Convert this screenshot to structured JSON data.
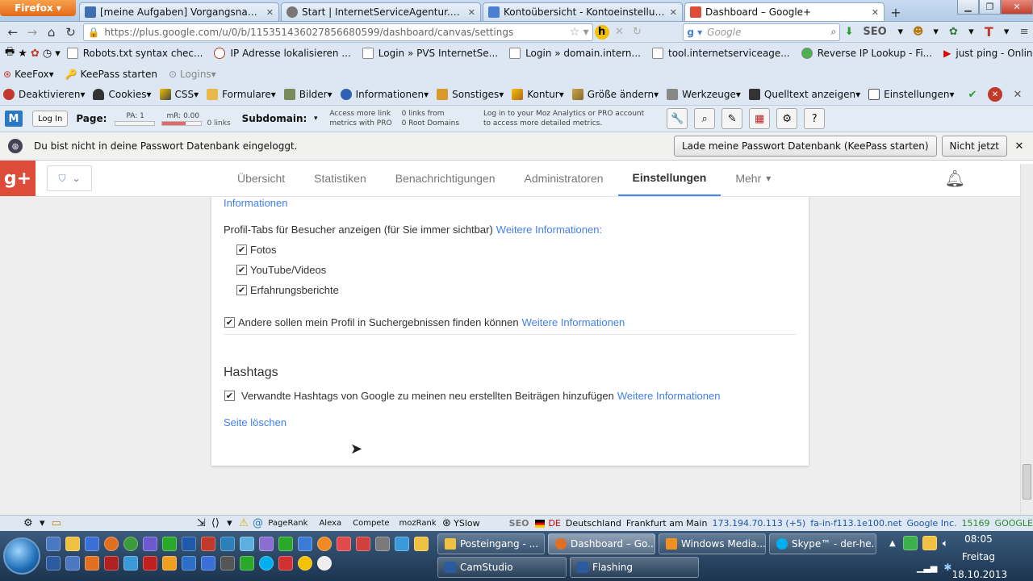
{
  "browser": {
    "menu_label": "Firefox",
    "tabs": [
      {
        "label": "[meine Aufgaben] Vorgangsnavigato...",
        "icon": "tool-icon"
      },
      {
        "label": "Start | InternetServiceAgentur.com",
        "icon": "site-icon"
      },
      {
        "label": "Kontoübersicht - Kontoeinstellungen",
        "icon": "google-icon"
      },
      {
        "label": "Dashboard – Google+",
        "icon": "gplus-icon"
      }
    ],
    "new_tab": "+",
    "url": "https://plus.google.com/u/0/b/115351436027856680599/dashboard/canvas/settings",
    "search_placeholder": "Google"
  },
  "bookmarks": [
    "Robots.txt syntax chec...",
    "IP Adresse lokalisieren ...",
    "Login » PVS InternetSe...",
    "Login » domain.intern...",
    "tool.internetserviceage...",
    "Reverse IP Lookup - Fi...",
    "just ping - Online ping..."
  ],
  "keefox": {
    "keefox": "KeeFox",
    "keepass": "KeePass starten",
    "logins": "Logins"
  },
  "webdev": [
    "Deaktivieren",
    "Cookies",
    "CSS",
    "Formulare",
    "Bilder",
    "Informationen",
    "Sonstiges",
    "Kontur",
    "Größe ändern",
    "Werkzeuge",
    "Quelltext anzeigen",
    "Einstellungen"
  ],
  "moz": {
    "login": "Log In",
    "page": "Page:",
    "pa": "PA: 1",
    "mr": "mR: 0.00",
    "links": "0 links",
    "subdomain": "Subdomain:",
    "access1": "Access more link",
    "access2": "metrics with PRO",
    "links_from": "0 links from",
    "root_domains": "0 Root Domains",
    "login_msg1": "Log in to your Moz Analytics or PRO account",
    "login_msg2": "to access more detailed metrics."
  },
  "keepass_bar": {
    "message": "Du bist nicht in deine Passwort Datenbank eingeloggt.",
    "load_button": "Lade meine Passwort Datenbank (KeePass starten)",
    "not_now": "Nicht jetzt"
  },
  "gplus": {
    "logo": "g+",
    "tabs": [
      "Übersicht",
      "Statistiken",
      "Benachrichtigungen",
      "Administratoren",
      "Einstellungen",
      "Mehr"
    ],
    "active_tab": "Einstellungen"
  },
  "settings": {
    "info_cut": "Informationen",
    "profile_tabs_label": "Profil-Tabs für Besucher anzeigen (für Sie immer sichtbar)",
    "more_info_colon": "Weitere Informationen:",
    "options": [
      "Fotos",
      "YouTube/Videos",
      "Erfahrungsberichte"
    ],
    "search_label": "Andere sollen mein Profil in Suchergebnissen finden können",
    "more_info": "Weitere Informationen",
    "hashtags_title": "Hashtags",
    "hashtags_label": "Verwandte Hashtags von Google zu meinen neu erstellten Beiträgen hinzufügen",
    "delete_page": "Seite löschen"
  },
  "statusbar": {
    "pagerank": "PageRank",
    "alexa": "Alexa",
    "compete": "Compete",
    "mozrank": "mozRank",
    "yslow": "YSlow",
    "seo": "SEO",
    "de": "DE",
    "country": "Deutschland",
    "city": "Frankfurt am Main",
    "ip": "173.194.70.113 (+5)",
    "host": "fa-in-f113.1e100.net",
    "org": "Google Inc.",
    "asn": "15169",
    "asname": "GOOGLE"
  },
  "taskbar": {
    "row1": [
      "Posteingang - ...",
      "Dashboard – Go...",
      "Windows Media...",
      "Skype™ - der-he..."
    ],
    "row2": [
      "CamStudio",
      "Flashing"
    ],
    "time": "08:05",
    "day": "Freitag",
    "date": "18.10.2013"
  },
  "colors": {
    "gplus_red": "#dd4b39",
    "link": "#427fed",
    "active_tab_underline": "#4285f4"
  }
}
